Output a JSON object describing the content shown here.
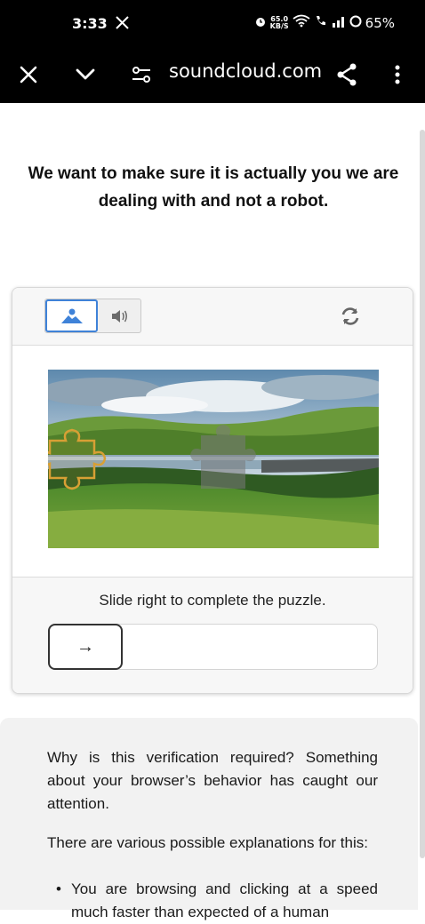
{
  "status_bar": {
    "time": "3:33",
    "net_speed_top": "65.0",
    "net_speed_bottom": "KB/S",
    "battery": "65%"
  },
  "browser": {
    "url": "soundcloud.com"
  },
  "page": {
    "heading": "We want to make sure it is actually you we are dealing with and not a robot."
  },
  "captcha": {
    "instruction": "Slide right to complete the puzzle.",
    "slider_arrow": "→"
  },
  "info": {
    "paragraph1": "Why is this verification required? Something about your browser’s behavior has caught our attention.",
    "paragraph2": "There are various possible explanations for this:",
    "bullet1": "You are browsing and clicking at a speed much faster than expected of a human"
  },
  "colors": {
    "accent": "#3f82d8",
    "puzzle_outline": "#d8a035"
  }
}
